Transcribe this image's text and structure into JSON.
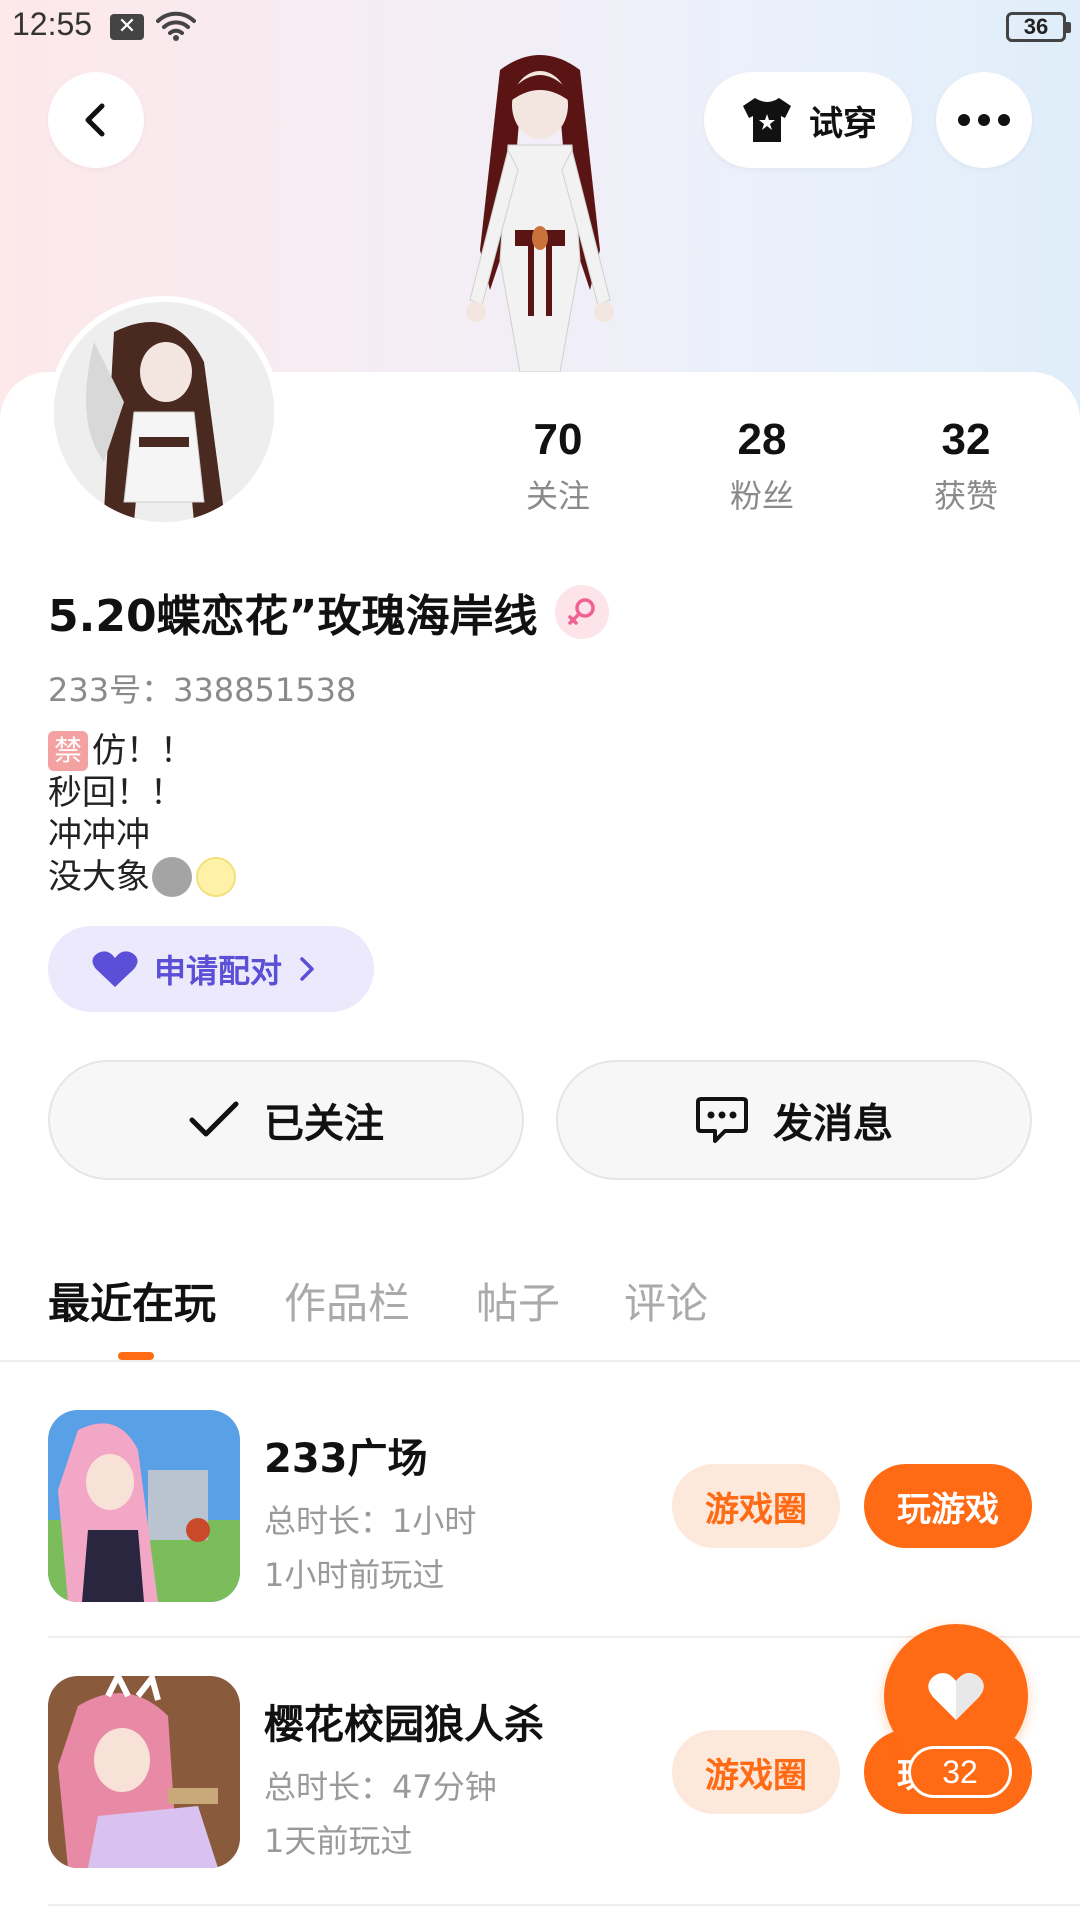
{
  "status_bar": {
    "time": "12:55",
    "battery": "36"
  },
  "header": {
    "try_on_label": "试穿"
  },
  "profile": {
    "stats": [
      {
        "value": "70",
        "label": "关注"
      },
      {
        "value": "28",
        "label": "粉丝"
      },
      {
        "value": "32",
        "label": "获赞"
      }
    ],
    "username": "5.20蝶恋花”玫瑰海岸线",
    "gender": "female",
    "user_id": "233号：338851538",
    "bio": {
      "line1_badge": "禁",
      "line1_text": "仿！！",
      "line2": "秒回！！",
      "line3": "冲冲冲",
      "line4_text": "没大象"
    },
    "pair_button": "申请配对",
    "follow_button": "已关注",
    "message_button": "发消息"
  },
  "tabs": [
    {
      "label": "最近在玩",
      "active": true
    },
    {
      "label": "作品栏",
      "active": false
    },
    {
      "label": "帖子",
      "active": false
    },
    {
      "label": "评论",
      "active": false
    }
  ],
  "games": [
    {
      "title": "233广场",
      "duration": "总时长：1小时",
      "last_played": "1小时前玩过",
      "circle_button": "游戏圈",
      "play_button": "玩游戏"
    },
    {
      "title": "樱花校园狼人杀",
      "duration": "总时长：47分钟",
      "last_played": "1天前玩过",
      "circle_button": "游戏圈",
      "play_button": "玩游戏"
    }
  ],
  "floating_like": {
    "count": "32"
  },
  "colors": {
    "accent": "#ff6a14",
    "pair": "#5a4fd6"
  }
}
